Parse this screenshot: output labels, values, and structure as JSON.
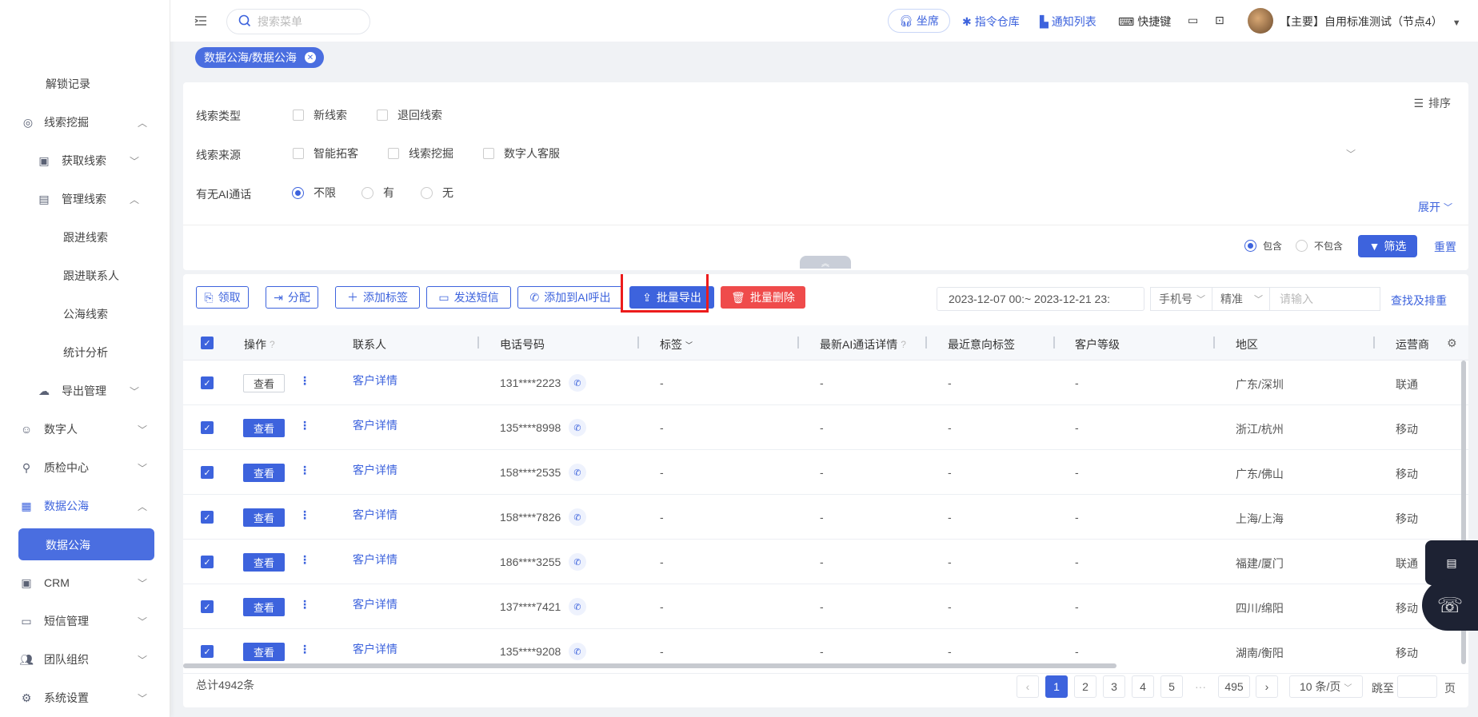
{
  "sidebar": {
    "items": [
      {
        "label": "解锁记录",
        "icon": "none",
        "arrow": ""
      },
      {
        "label": "线索挖掘",
        "icon": "target-icon",
        "arrow": "up"
      },
      {
        "label": "获取线索",
        "icon": "id-card-icon",
        "arrow": "down"
      },
      {
        "label": "管理线索",
        "icon": "contact-folder-icon",
        "arrow": "up"
      },
      {
        "label": "跟进线索",
        "icon": "none",
        "arrow": ""
      },
      {
        "label": "跟进联系人",
        "icon": "none",
        "arrow": ""
      },
      {
        "label": "公海线索",
        "icon": "none",
        "arrow": ""
      },
      {
        "label": "统计分析",
        "icon": "none",
        "arrow": ""
      },
      {
        "label": "导出管理",
        "icon": "cloud-upload-icon",
        "arrow": "down"
      },
      {
        "label": "数字人",
        "icon": "digital-human-icon",
        "arrow": "down"
      },
      {
        "label": "质检中心",
        "icon": "magnifier-icon",
        "arrow": "down"
      },
      {
        "label": "数据公海",
        "icon": "chart-icon",
        "arrow": "up"
      },
      {
        "label": "CRM",
        "icon": "crm-icon",
        "arrow": "down"
      },
      {
        "label": "短信管理",
        "icon": "message-icon",
        "arrow": "down"
      },
      {
        "label": "团队组织",
        "icon": "team-icon",
        "arrow": "down"
      },
      {
        "label": "系统设置",
        "icon": "settings-icon",
        "arrow": "down"
      }
    ],
    "active_item": "数据公海"
  },
  "header": {
    "search_placeholder": "搜索菜单",
    "seat_label": "坐席",
    "links": [
      "指令仓库",
      "通知列表",
      "快捷键"
    ],
    "user": "【主要】自用标准测试（节点4）"
  },
  "breadcrumb_tag": "数据公海/数据公海",
  "filters": {
    "sort_label": "排序",
    "expand_label": "展开",
    "rows": [
      {
        "label": "线索类型",
        "options": [
          "新线索",
          "退回线索"
        ]
      },
      {
        "label": "线索来源",
        "options": [
          "智能拓客",
          "线索挖掘",
          "数字人客服"
        ]
      },
      {
        "label": "有无AI通话",
        "options": [
          "不限",
          "有",
          "无"
        ],
        "selected": "不限"
      }
    ],
    "include_label": "包含",
    "exclude_label": "不包含",
    "filter_button": "筛选",
    "reset_button": "重置"
  },
  "toolbar": {
    "claim": "领取",
    "assign": "分配",
    "add_tag": "添加标签",
    "send_sms": "发送短信",
    "add_ai_call": "添加到AI呼出",
    "batch_export": "批量导出",
    "batch_delete": "批量删除",
    "date_range": "2023-12-07 00:~ 2023-12-21 23:",
    "field_select": "手机号",
    "match_select": "精准",
    "keyword_placeholder": "请输入",
    "find_dedupe": "查找及排重"
  },
  "table": {
    "columns": [
      "操作",
      "联系人",
      "电话号码",
      "标签",
      "最新AI通话详情",
      "最近意向标签",
      "客户等级",
      "地区",
      "运营商"
    ],
    "view_label": "查看",
    "detail_label": "客户详情",
    "rows": [
      {
        "phone": "131****2223",
        "tag": "-",
        "ai": "-",
        "intent": "-",
        "level": "-",
        "region": "广东/深圳",
        "carrier": "联通"
      },
      {
        "phone": "135****8998",
        "tag": "-",
        "ai": "-",
        "intent": "-",
        "level": "-",
        "region": "浙江/杭州",
        "carrier": "移动"
      },
      {
        "phone": "158****2535",
        "tag": "-",
        "ai": "-",
        "intent": "-",
        "level": "-",
        "region": "广东/佛山",
        "carrier": "移动"
      },
      {
        "phone": "158****7826",
        "tag": "-",
        "ai": "-",
        "intent": "-",
        "level": "-",
        "region": "上海/上海",
        "carrier": "移动"
      },
      {
        "phone": "186****3255",
        "tag": "-",
        "ai": "-",
        "intent": "-",
        "level": "-",
        "region": "福建/厦门",
        "carrier": "联通"
      },
      {
        "phone": "137****7421",
        "tag": "-",
        "ai": "-",
        "intent": "-",
        "level": "-",
        "region": "四川/绵阳",
        "carrier": "移动"
      },
      {
        "phone": "135****9208",
        "tag": "-",
        "ai": "-",
        "intent": "-",
        "level": "-",
        "region": "湖南/衡阳",
        "carrier": "移动"
      }
    ]
  },
  "pagination": {
    "total": "总计4942条",
    "pages": [
      "1",
      "2",
      "3",
      "4",
      "5"
    ],
    "ellipsis": "···",
    "last_page": "495",
    "current": "1",
    "page_size": "10 条/页",
    "goto_label": "跳至",
    "page_suffix": "页"
  },
  "colors": {
    "accent": "#3d63dd",
    "danger": "#ef4b4b",
    "highlight": "#ec1c1c"
  }
}
